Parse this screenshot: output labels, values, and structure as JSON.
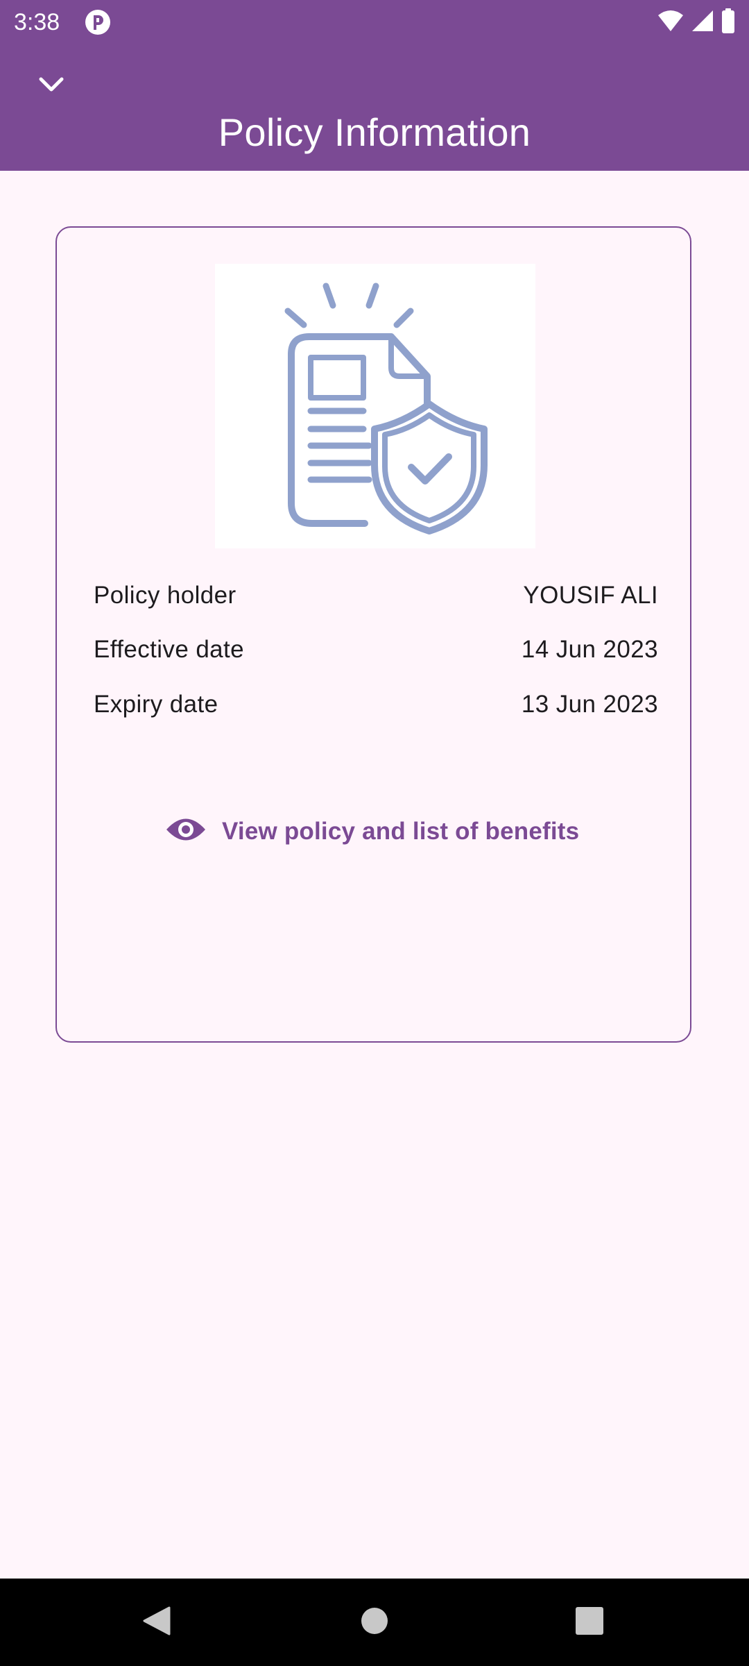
{
  "status_bar": {
    "time": "3:38",
    "icons": [
      "app-notification-icon",
      "wifi-icon",
      "cellular-signal-icon",
      "battery-icon"
    ]
  },
  "header": {
    "title": "Policy Information",
    "back_icon": "chevron-down-icon"
  },
  "card": {
    "illustration_icon": "policy-document-shield-icon",
    "rows": [
      {
        "label": "Policy holder",
        "value": "YOUSIF ALI"
      },
      {
        "label": "Effective date",
        "value": "14 Jun 2023"
      },
      {
        "label": "Expiry date",
        "value": "13 Jun 2023"
      }
    ],
    "view_link": {
      "icon": "eye-icon",
      "label": "View policy and list of benefits"
    }
  },
  "nav_bar": {
    "buttons": [
      "back-triangle-icon",
      "home-circle-icon",
      "recents-square-icon"
    ]
  },
  "colors": {
    "primary": "#7b4a94",
    "background": "#fff5fb",
    "illustration": "#8fa1cc",
    "text": "#1d1b1e"
  }
}
